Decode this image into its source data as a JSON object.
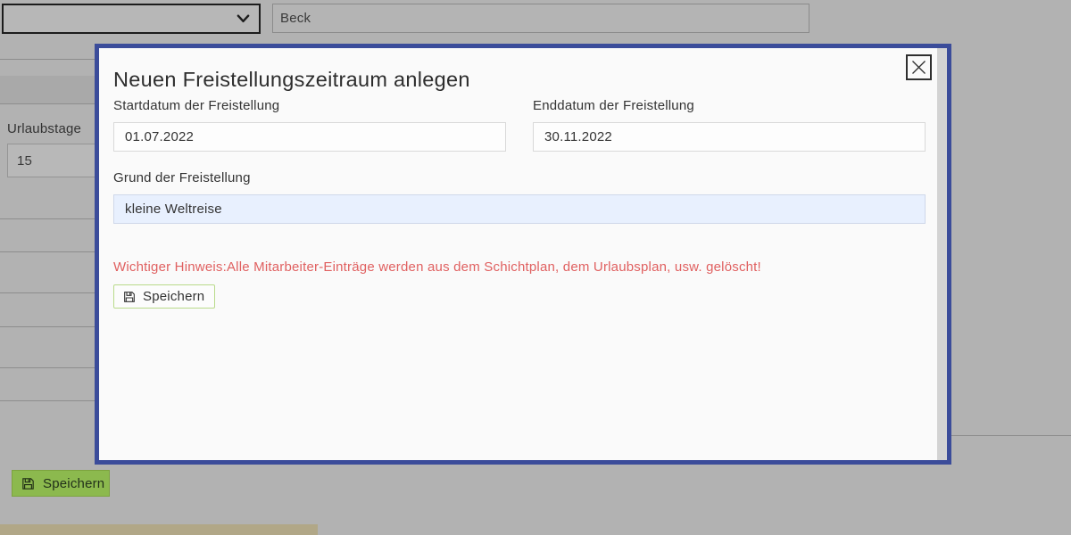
{
  "background": {
    "top_select": {
      "selected": ""
    },
    "name_input": {
      "value": "Beck"
    },
    "vacation_days": {
      "label": "Urlaubstage",
      "value": "15"
    },
    "save_button": {
      "label": "Speichern"
    }
  },
  "modal": {
    "title": "Neuen Freistellungszeitraum anlegen",
    "start_field": {
      "label": "Startdatum der Freistellung",
      "value": "01.07.2022"
    },
    "end_field": {
      "label": "Enddatum der Freistellung",
      "value": "30.11.2022"
    },
    "reason_field": {
      "label": "Grund der Freistellung",
      "value": "kleine Weltreise"
    },
    "warning_text": "Wichtiger Hinweis:Alle Mitarbeiter-Einträge werden aus dem Schichtplan, dem Urlaubsplan, usw. gelöscht!",
    "save_button": {
      "label": "Speichern"
    }
  },
  "colors": {
    "modal_border": "#3b4c9a",
    "warning_red": "#e06060",
    "save_green_bg": "#8cb94e",
    "autofill_blue": "#e8f0fe"
  }
}
